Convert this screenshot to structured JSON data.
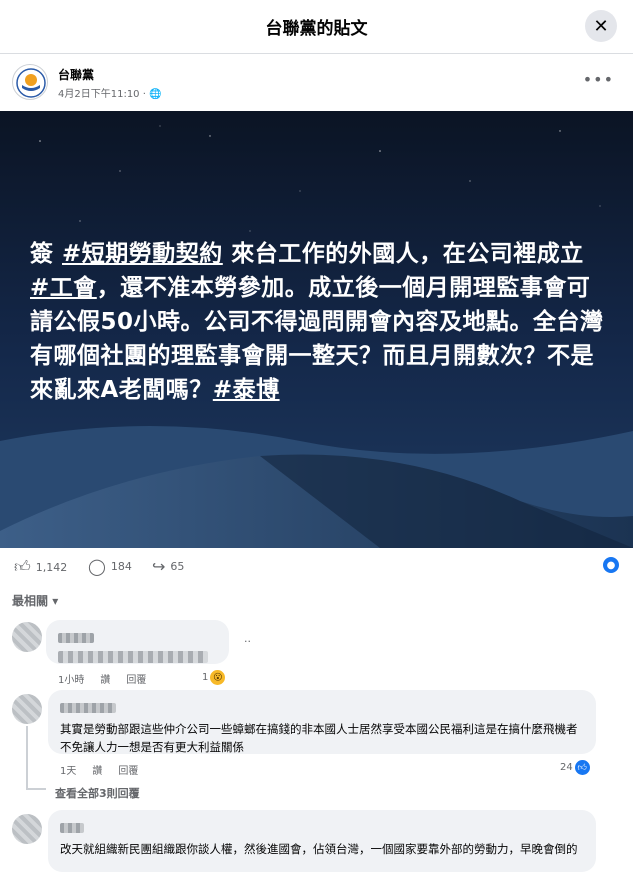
{
  "header": {
    "title": "台聯黨的貼文",
    "close_icon": "close-icon"
  },
  "post": {
    "author": "台聯黨",
    "timestamp": "4月2日下午11:10",
    "privacy_icon": "globe-icon",
    "more_icon": "more-icon",
    "image_text": {
      "prefix": "簽 ",
      "tag1": "#短期勞動契約",
      "part1": " 來台工作的外國人，在公司裡成立 ",
      "tag2": "#工會",
      "part2": "，還不准本勞參加。成立後一個月開理監事會可請公假50小時。公司不得過問開會內容及地點。全台灣有哪個社團的理監事會開一整天？而且月開數次？不是來亂來A老闆嗎？",
      "tag3": "#泰博"
    },
    "stats": {
      "likes": "1,142",
      "comments": "184",
      "shares": "65"
    }
  },
  "sort_label": "最相關",
  "comments": [
    {
      "time": "1小時",
      "like_label": "讚",
      "reply_label": "回覆",
      "reaction_count": "1",
      "trailing": "..",
      "reaction_color": "#f7b928"
    },
    {
      "text": "其實是勞動部跟這些仲介公司一些蟑螂在搞錢的非本國人士居然享受本國公民福利這是在搞什麼飛機者不免讓人力一想是否有更大利益關係",
      "time": "1天",
      "like_label": "讚",
      "reply_label": "回覆",
      "reaction_count": "24",
      "reaction_color": "#1877f2"
    },
    {
      "text": "改天就組織新民團組織跟你談人權，然後進國會，佔領台灣，一個國家要靠外部的勞動力，早晚會倒的"
    }
  ],
  "view_replies": "查看全部3則回覆"
}
